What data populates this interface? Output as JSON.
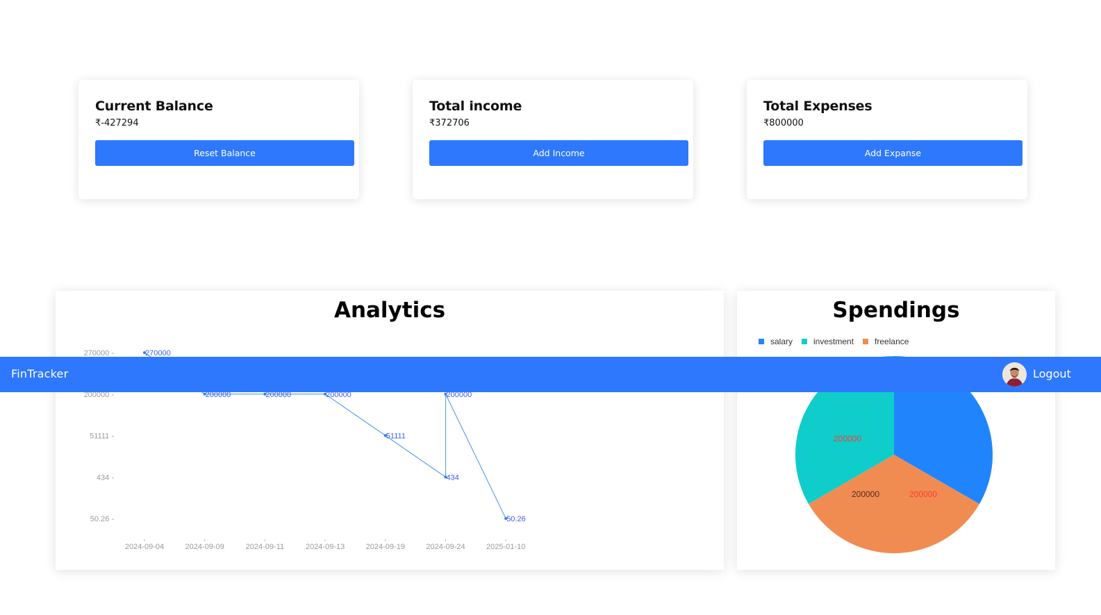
{
  "cards": [
    {
      "title": "Current Balance",
      "value": "₹-427294",
      "button": "Reset Balance"
    },
    {
      "title": "Total income",
      "value": "₹372706",
      "button": "Add Income"
    },
    {
      "title": "Total Expenses",
      "value": "₹800000",
      "button": "Add Expanse"
    }
  ],
  "navbar": {
    "brand": "FinTracker",
    "logout": "Logout"
  },
  "analytics": {
    "title": "Analytics"
  },
  "spendings": {
    "title": "Spendings",
    "legend": [
      {
        "label": "salary",
        "color": "#2085fd"
      },
      {
        "label": "investment",
        "color": "#0ecdcb"
      },
      {
        "label": "freelance",
        "color": "#f08c52"
      }
    ]
  },
  "colors": {
    "accent": "#2d78fd",
    "line": "#2d78fd",
    "pie_label": "#ff3b30"
  },
  "chart_data": [
    {
      "type": "line",
      "x": [
        "2024-09-04",
        "2024-09-09",
        "2024-09-11",
        "2024-09-13",
        "2024-09-19",
        "2024-09-24",
        "2024-09-24",
        "2025-01-10"
      ],
      "x_ticks": [
        "2024-09-04",
        "2024-09-09",
        "2024-09-11",
        "2024-09-13",
        "2024-09-19",
        "2024-09-24",
        "2025-01-10"
      ],
      "y_ticks": [
        "270000",
        "200000",
        "51111",
        "434",
        "50.26"
      ],
      "y_scale": "categorical",
      "values": [
        270000,
        200000,
        200000,
        200000,
        51111,
        434,
        200000,
        50.26
      ],
      "point_labels": [
        "270000",
        "200000",
        "200000",
        "200000",
        "51111",
        "434",
        "200000",
        "50.26"
      ],
      "grid": false
    },
    {
      "type": "pie",
      "slices": [
        {
          "label": "salary",
          "value": 200000,
          "color": "#2085fd"
        },
        {
          "label": "investment",
          "value": 200000,
          "color": "#0ecdcb"
        },
        {
          "label": "freelance",
          "value": 200000,
          "color": "#f08c52"
        }
      ],
      "legend_position": "top-left"
    }
  ]
}
